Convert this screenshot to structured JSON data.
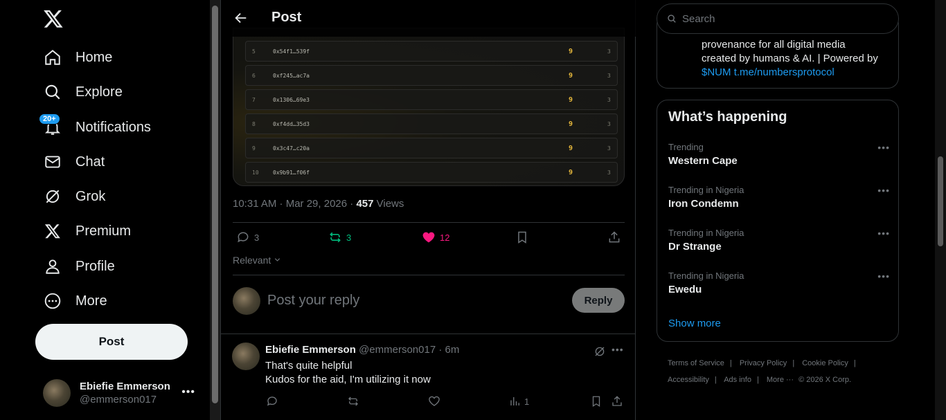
{
  "nav": {
    "items": [
      {
        "label": "Home",
        "icon": "home-icon"
      },
      {
        "label": "Explore",
        "icon": "search-icon"
      },
      {
        "label": "Notifications",
        "icon": "bell-icon",
        "badge": "20+"
      },
      {
        "label": "Chat",
        "icon": "mail-icon"
      },
      {
        "label": "Grok",
        "icon": "grok-icon"
      },
      {
        "label": "Premium",
        "icon": "x-logo-icon"
      },
      {
        "label": "Profile",
        "icon": "person-icon"
      },
      {
        "label": "More",
        "icon": "more-circle-icon"
      }
    ],
    "post_label": "Post"
  },
  "account": {
    "name": "Ebiefie Emmerson",
    "handle": "@emmerson017"
  },
  "header": {
    "title": "Post"
  },
  "leaderboard": [
    {
      "rank": "5",
      "address": "0x54f1…539f",
      "score": "9",
      "count": "3"
    },
    {
      "rank": "6",
      "address": "0xf245…ac7a",
      "score": "9",
      "count": "3"
    },
    {
      "rank": "7",
      "address": "0x1306…69e3",
      "score": "9",
      "count": "3"
    },
    {
      "rank": "8",
      "address": "0xf4dd…35d3",
      "score": "9",
      "count": "3"
    },
    {
      "rank": "9",
      "address": "0x3c47…c20a",
      "score": "9",
      "count": "3"
    },
    {
      "rank": "10",
      "address": "0x9b91…f06f",
      "score": "9",
      "count": "3"
    }
  ],
  "post": {
    "time": "10:31 AM · Mar 29, 2026 · ",
    "views_count": "457",
    "views_label": " Views",
    "replies": "3",
    "reposts": "3",
    "likes": "12"
  },
  "sort": {
    "label": "Relevant"
  },
  "reply_box": {
    "placeholder": "Post your reply",
    "button": "Reply"
  },
  "comment": {
    "name": "Ebiefie Emmerson",
    "handle": "@emmerson017 · 6m",
    "line1": "That's quite helpful",
    "line2": "Kudos for the aid, I'm utilizing it now",
    "views": "1"
  },
  "search": {
    "placeholder": "Search"
  },
  "bio": {
    "line1": "provenance for all digital media",
    "line2": "created by humans & AI. | Powered by",
    "link1": "$NUM",
    "link2": "t.me/numbersprotocol"
  },
  "trends": {
    "title": "What’s happening",
    "items": [
      {
        "context": "Trending",
        "name": "Western Cape"
      },
      {
        "context": "Trending in Nigeria",
        "name": "Iron Condemn"
      },
      {
        "context": "Trending in Nigeria",
        "name": "Dr Strange"
      },
      {
        "context": "Trending in Nigeria",
        "name": "Ewedu"
      }
    ],
    "show_more": "Show more"
  },
  "footer": {
    "links": [
      "Terms of Service",
      "Privacy Policy",
      "Cookie Policy",
      "Accessibility",
      "Ads info",
      "More ···"
    ],
    "copyright": "© 2026 X Corp."
  },
  "colors": {
    "accent": "#1d9bf0",
    "like": "#f91880",
    "repost": "#00ba7c",
    "score": "#e5b73b"
  }
}
